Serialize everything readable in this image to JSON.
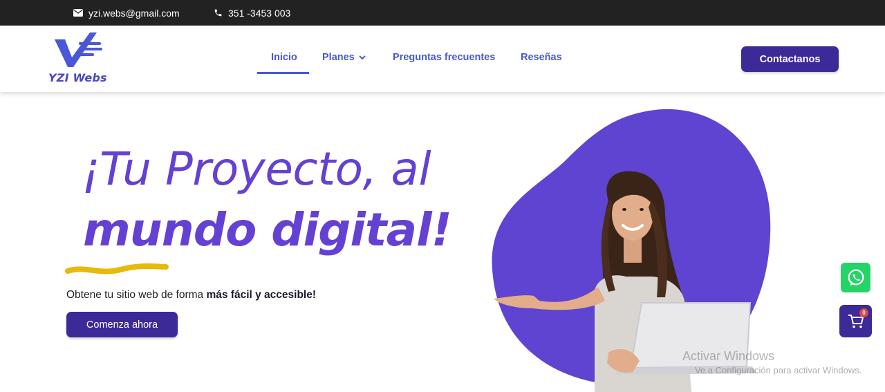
{
  "topbar": {
    "email": "yzi.webs@gmail.com",
    "phone": "351 -3453 003"
  },
  "logo": {
    "text": "YZI Webs"
  },
  "nav": {
    "items": [
      {
        "label": "Inicio",
        "active": true
      },
      {
        "label": "Planes",
        "has_dropdown": true
      },
      {
        "label": "Preguntas frecuentes"
      },
      {
        "label": "Reseñas"
      }
    ]
  },
  "header": {
    "contact_label": "Contactanos"
  },
  "hero": {
    "line1": "¡Tu Proyecto, al",
    "line2": "mundo digital!",
    "subtitle_plain": "Obtene tu sitio web de forma ",
    "subtitle_bold": "más fácil y accesible!",
    "cta_label": "Comenza ahora"
  },
  "floating": {
    "whatsapp_icon": "whatsapp-icon",
    "cart_icon": "cart-icon",
    "cart_count": "0"
  },
  "watermark": {
    "title": "Activar Windows",
    "subtitle": "Ve a Configuración para activar Windows."
  },
  "colors": {
    "topbar_bg": "#222222",
    "accent_purple": "#6441d3",
    "button_purple": "#3b2a98",
    "nav_blue": "#4a57d6",
    "squiggle_yellow": "#e8b90c",
    "whatsapp_green": "#25d366"
  }
}
